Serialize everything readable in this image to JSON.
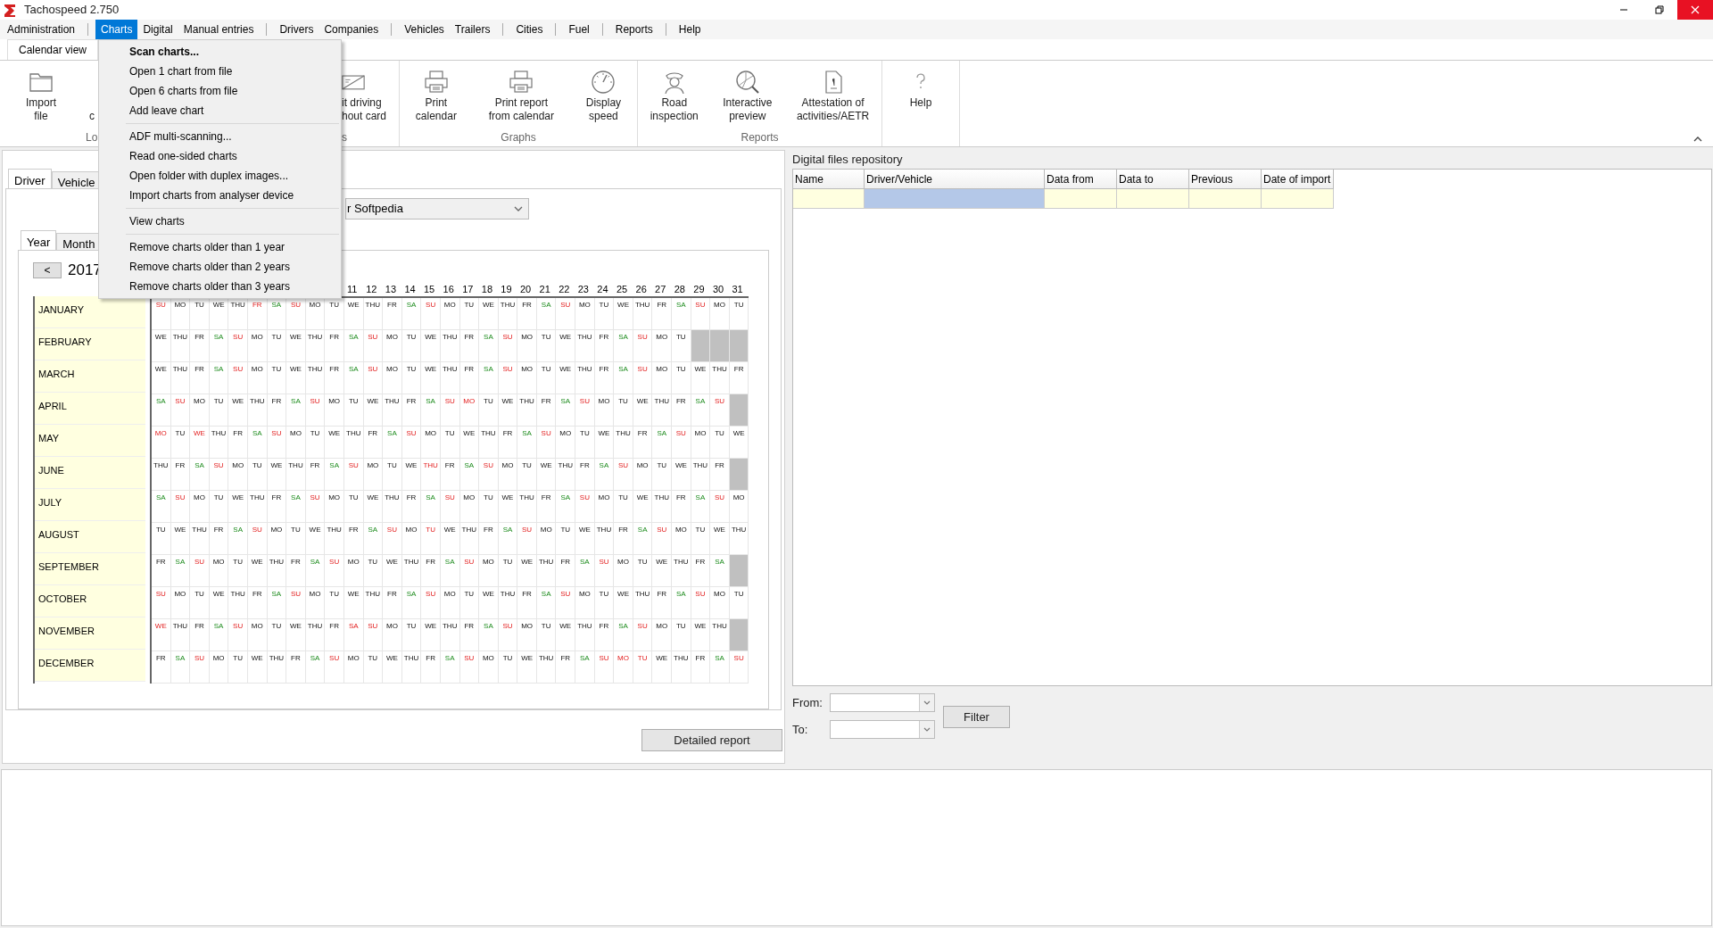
{
  "window": {
    "title": "Tachospeed 2.750"
  },
  "menu_bar": [
    {
      "label": "Administration",
      "selected": false,
      "separator_after": true
    },
    {
      "label": "Charts",
      "selected": true,
      "separator_after": false
    },
    {
      "label": "Digital",
      "selected": false,
      "separator_after": false
    },
    {
      "label": "Manual entries",
      "selected": false,
      "separator_after": true
    },
    {
      "label": "Drivers",
      "selected": false,
      "separator_after": false
    },
    {
      "label": "Companies",
      "selected": false,
      "separator_after": true
    },
    {
      "label": "Vehicles",
      "selected": false,
      "separator_after": false
    },
    {
      "label": "Trailers",
      "selected": false,
      "separator_after": true
    },
    {
      "label": "Cities",
      "selected": false,
      "separator_after": true
    },
    {
      "label": "Fuel",
      "selected": false,
      "separator_after": true
    },
    {
      "label": "Reports",
      "selected": false,
      "separator_after": true
    },
    {
      "label": "Help",
      "selected": false,
      "separator_after": false
    }
  ],
  "view_tab": {
    "label": "Calendar view"
  },
  "ribbon": {
    "groups": [
      {
        "label": "Lo",
        "buttons": [
          {
            "lines": [
              "Import",
              "file"
            ],
            "kind": "full"
          },
          {
            "lines": [
              "c"
            ],
            "kind": "clipped"
          }
        ]
      },
      {
        "label": "s",
        "buttons": [
          {
            "lines": [
              "it driving",
              "hout card"
            ],
            "kind": "clipped"
          }
        ]
      },
      {
        "label": "Graphs",
        "buttons": [
          {
            "lines": [
              "Print",
              "calendar"
            ],
            "kind": "full"
          },
          {
            "lines": [
              "Print report",
              "from calendar"
            ],
            "kind": "full"
          },
          {
            "lines": [
              "Display",
              "speed"
            ],
            "kind": "full"
          }
        ]
      },
      {
        "label": "Reports",
        "buttons": [
          {
            "lines": [
              "Road",
              "inspection"
            ],
            "kind": "full"
          },
          {
            "lines": [
              "Interactive",
              "preview"
            ],
            "kind": "full"
          },
          {
            "lines": [
              "Attestation of",
              "activities/AETR"
            ],
            "kind": "full"
          }
        ]
      },
      {
        "buttons": [
          {
            "lines": [
              "Help"
            ],
            "kind": "full"
          }
        ]
      }
    ]
  },
  "charts_menu": {
    "groups": [
      [
        {
          "label": "Scan charts...",
          "default": true
        },
        {
          "label": "Open 1 chart from file",
          "default": false
        },
        {
          "label": "Open 6 charts from file",
          "default": false
        },
        {
          "label": "Add leave chart",
          "default": false
        }
      ],
      [
        {
          "label": "ADF multi-scanning...",
          "default": false
        },
        {
          "label": "Read one-sided charts",
          "default": false
        },
        {
          "label": "Open folder with duplex images...",
          "default": false
        },
        {
          "label": "Import charts from analyser device",
          "default": false
        }
      ],
      [
        {
          "label": "View charts",
          "default": false
        }
      ],
      [
        {
          "label": "Remove charts older than 1 year",
          "default": false
        },
        {
          "label": "Remove charts older than 2 years",
          "default": false
        },
        {
          "label": "Remove charts older than 3 years",
          "default": false
        }
      ]
    ]
  },
  "left_panel": {
    "tabs": [
      {
        "label": "Driver",
        "selected": true
      },
      {
        "label": "Vehicle",
        "selected": false
      }
    ],
    "driver_select": {
      "value": "r Softpedia"
    },
    "period_tabs": [
      {
        "label": "Year",
        "selected": true
      },
      {
        "label": "Month",
        "selected": false
      }
    ],
    "prev_button": "<",
    "year": "2017",
    "day_numbers": [
      "11",
      "12",
      "13",
      "14",
      "15",
      "16",
      "17",
      "18",
      "19",
      "20",
      "21",
      "22",
      "23",
      "24",
      "25",
      "26",
      "27",
      "28",
      "29",
      "30",
      "31"
    ],
    "months": [
      {
        "name": "JANUARY",
        "days": [
          {
            "label": "SU",
            "kind": "red"
          },
          {
            "label": "MO",
            "kind": "work"
          },
          {
            "label": "TU",
            "kind": "work"
          },
          {
            "label": "WE",
            "kind": "work"
          },
          {
            "label": "THU",
            "kind": "work"
          },
          {
            "label": "FR",
            "kind": "red"
          },
          {
            "label": "SA",
            "kind": "sat"
          },
          {
            "label": "SU",
            "kind": "red"
          },
          {
            "label": "MO",
            "kind": "work"
          },
          {
            "label": "TU",
            "kind": "work"
          },
          {
            "label": "WE",
            "kind": "work"
          },
          {
            "label": "THU",
            "kind": "work"
          },
          {
            "label": "FR",
            "kind": "work"
          },
          {
            "label": "SA",
            "kind": "sat"
          },
          {
            "label": "SU",
            "kind": "red"
          },
          {
            "label": "MO",
            "kind": "work"
          },
          {
            "label": "TU",
            "kind": "work"
          },
          {
            "label": "WE",
            "kind": "work"
          },
          {
            "label": "THU",
            "kind": "work"
          },
          {
            "label": "FR",
            "kind": "work"
          },
          {
            "label": "SA",
            "kind": "sat"
          },
          {
            "label": "SU",
            "kind": "red"
          },
          {
            "label": "MO",
            "kind": "work"
          },
          {
            "label": "TU",
            "kind": "work"
          },
          {
            "label": "WE",
            "kind": "work"
          },
          {
            "label": "THU",
            "kind": "work"
          },
          {
            "label": "FR",
            "kind": "work"
          },
          {
            "label": "SA",
            "kind": "sat"
          },
          {
            "label": "SU",
            "kind": "red"
          },
          {
            "label": "MO",
            "kind": "work"
          },
          {
            "label": "TU",
            "kind": "work"
          }
        ]
      },
      {
        "name": "FEBRUARY",
        "days": [
          {
            "label": "WE",
            "kind": "work"
          },
          {
            "label": "THU",
            "kind": "work"
          },
          {
            "label": "FR",
            "kind": "work"
          },
          {
            "label": "SA",
            "kind": "sat"
          },
          {
            "label": "SU",
            "kind": "red"
          },
          {
            "label": "MO",
            "kind": "work"
          },
          {
            "label": "TU",
            "kind": "work"
          },
          {
            "label": "WE",
            "kind": "work"
          },
          {
            "label": "THU",
            "kind": "work"
          },
          {
            "label": "FR",
            "kind": "work"
          },
          {
            "label": "SA",
            "kind": "sat"
          },
          {
            "label": "SU",
            "kind": "red"
          },
          {
            "label": "MO",
            "kind": "work"
          },
          {
            "label": "TU",
            "kind": "work"
          },
          {
            "label": "WE",
            "kind": "work"
          },
          {
            "label": "THU",
            "kind": "work"
          },
          {
            "label": "FR",
            "kind": "work"
          },
          {
            "label": "SA",
            "kind": "sat"
          },
          {
            "label": "SU",
            "kind": "red"
          },
          {
            "label": "MO",
            "kind": "work"
          },
          {
            "label": "TU",
            "kind": "work"
          },
          {
            "label": "WE",
            "kind": "work"
          },
          {
            "label": "THU",
            "kind": "work"
          },
          {
            "label": "FR",
            "kind": "work"
          },
          {
            "label": "SA",
            "kind": "sat"
          },
          {
            "label": "SU",
            "kind": "red"
          },
          {
            "label": "MO",
            "kind": "work"
          },
          {
            "label": "TU",
            "kind": "work"
          }
        ]
      },
      {
        "name": "MARCH",
        "days": [
          {
            "label": "WE",
            "kind": "work"
          },
          {
            "label": "THU",
            "kind": "work"
          },
          {
            "label": "FR",
            "kind": "work"
          },
          {
            "label": "SA",
            "kind": "sat"
          },
          {
            "label": "SU",
            "kind": "red"
          },
          {
            "label": "MO",
            "kind": "work"
          },
          {
            "label": "TU",
            "kind": "work"
          },
          {
            "label": "WE",
            "kind": "work"
          },
          {
            "label": "THU",
            "kind": "work"
          },
          {
            "label": "FR",
            "kind": "work"
          },
          {
            "label": "SA",
            "kind": "sat"
          },
          {
            "label": "SU",
            "kind": "red"
          },
          {
            "label": "MO",
            "kind": "work"
          },
          {
            "label": "TU",
            "kind": "work"
          },
          {
            "label": "WE",
            "kind": "work"
          },
          {
            "label": "THU",
            "kind": "work"
          },
          {
            "label": "FR",
            "kind": "work"
          },
          {
            "label": "SA",
            "kind": "sat"
          },
          {
            "label": "SU",
            "kind": "red"
          },
          {
            "label": "MO",
            "kind": "work"
          },
          {
            "label": "TU",
            "kind": "work"
          },
          {
            "label": "WE",
            "kind": "work"
          },
          {
            "label": "THU",
            "kind": "work"
          },
          {
            "label": "FR",
            "kind": "work"
          },
          {
            "label": "SA",
            "kind": "sat"
          },
          {
            "label": "SU",
            "kind": "red"
          },
          {
            "label": "MO",
            "kind": "work"
          },
          {
            "label": "TU",
            "kind": "work"
          },
          {
            "label": "WE",
            "kind": "work"
          },
          {
            "label": "THU",
            "kind": "work"
          },
          {
            "label": "FR",
            "kind": "work"
          }
        ]
      },
      {
        "name": "APRIL",
        "days": [
          {
            "label": "SA",
            "kind": "sat"
          },
          {
            "label": "SU",
            "kind": "red"
          },
          {
            "label": "MO",
            "kind": "work"
          },
          {
            "label": "TU",
            "kind": "work"
          },
          {
            "label": "WE",
            "kind": "work"
          },
          {
            "label": "THU",
            "kind": "work"
          },
          {
            "label": "FR",
            "kind": "work"
          },
          {
            "label": "SA",
            "kind": "sat"
          },
          {
            "label": "SU",
            "kind": "red"
          },
          {
            "label": "MO",
            "kind": "work"
          },
          {
            "label": "TU",
            "kind": "work"
          },
          {
            "label": "WE",
            "kind": "work"
          },
          {
            "label": "THU",
            "kind": "work"
          },
          {
            "label": "FR",
            "kind": "work"
          },
          {
            "label": "SA",
            "kind": "sat"
          },
          {
            "label": "SU",
            "kind": "red"
          },
          {
            "label": "MO",
            "kind": "red"
          },
          {
            "label": "TU",
            "kind": "work"
          },
          {
            "label": "WE",
            "kind": "work"
          },
          {
            "label": "THU",
            "kind": "work"
          },
          {
            "label": "FR",
            "kind": "work"
          },
          {
            "label": "SA",
            "kind": "sat"
          },
          {
            "label": "SU",
            "kind": "red"
          },
          {
            "label": "MO",
            "kind": "work"
          },
          {
            "label": "TU",
            "kind": "work"
          },
          {
            "label": "WE",
            "kind": "work"
          },
          {
            "label": "THU",
            "kind": "work"
          },
          {
            "label": "FR",
            "kind": "work"
          },
          {
            "label": "SA",
            "kind": "sat"
          },
          {
            "label": "SU",
            "kind": "red"
          }
        ]
      },
      {
        "name": "MAY",
        "days": [
          {
            "label": "MO",
            "kind": "red"
          },
          {
            "label": "TU",
            "kind": "work"
          },
          {
            "label": "WE",
            "kind": "red"
          },
          {
            "label": "THU",
            "kind": "work"
          },
          {
            "label": "FR",
            "kind": "work"
          },
          {
            "label": "SA",
            "kind": "sat"
          },
          {
            "label": "SU",
            "kind": "red"
          },
          {
            "label": "MO",
            "kind": "work"
          },
          {
            "label": "TU",
            "kind": "work"
          },
          {
            "label": "WE",
            "kind": "work"
          },
          {
            "label": "THU",
            "kind": "work"
          },
          {
            "label": "FR",
            "kind": "work"
          },
          {
            "label": "SA",
            "kind": "sat"
          },
          {
            "label": "SU",
            "kind": "red"
          },
          {
            "label": "MO",
            "kind": "work"
          },
          {
            "label": "TU",
            "kind": "work"
          },
          {
            "label": "WE",
            "kind": "work"
          },
          {
            "label": "THU",
            "kind": "work"
          },
          {
            "label": "FR",
            "kind": "work"
          },
          {
            "label": "SA",
            "kind": "sat"
          },
          {
            "label": "SU",
            "kind": "red"
          },
          {
            "label": "MO",
            "kind": "work"
          },
          {
            "label": "TU",
            "kind": "work"
          },
          {
            "label": "WE",
            "kind": "work"
          },
          {
            "label": "THU",
            "kind": "work"
          },
          {
            "label": "FR",
            "kind": "work"
          },
          {
            "label": "SA",
            "kind": "sat"
          },
          {
            "label": "SU",
            "kind": "red"
          },
          {
            "label": "MO",
            "kind": "work"
          },
          {
            "label": "TU",
            "kind": "work"
          },
          {
            "label": "WE",
            "kind": "work"
          }
        ]
      },
      {
        "name": "JUNE",
        "days": [
          {
            "label": "THU",
            "kind": "work"
          },
          {
            "label": "FR",
            "kind": "work"
          },
          {
            "label": "SA",
            "kind": "sat"
          },
          {
            "label": "SU",
            "kind": "red"
          },
          {
            "label": "MO",
            "kind": "work"
          },
          {
            "label": "TU",
            "kind": "work"
          },
          {
            "label": "WE",
            "kind": "work"
          },
          {
            "label": "THU",
            "kind": "work"
          },
          {
            "label": "FR",
            "kind": "work"
          },
          {
            "label": "SA",
            "kind": "sat"
          },
          {
            "label": "SU",
            "kind": "red"
          },
          {
            "label": "MO",
            "kind": "work"
          },
          {
            "label": "TU",
            "kind": "work"
          },
          {
            "label": "WE",
            "kind": "work"
          },
          {
            "label": "THU",
            "kind": "red"
          },
          {
            "label": "FR",
            "kind": "work"
          },
          {
            "label": "SA",
            "kind": "sat"
          },
          {
            "label": "SU",
            "kind": "red"
          },
          {
            "label": "MO",
            "kind": "work"
          },
          {
            "label": "TU",
            "kind": "work"
          },
          {
            "label": "WE",
            "kind": "work"
          },
          {
            "label": "THU",
            "kind": "work"
          },
          {
            "label": "FR",
            "kind": "work"
          },
          {
            "label": "SA",
            "kind": "sat"
          },
          {
            "label": "SU",
            "kind": "red"
          },
          {
            "label": "MO",
            "kind": "work"
          },
          {
            "label": "TU",
            "kind": "work"
          },
          {
            "label": "WE",
            "kind": "work"
          },
          {
            "label": "THU",
            "kind": "work"
          },
          {
            "label": "FR",
            "kind": "work"
          }
        ]
      },
      {
        "name": "JULY",
        "days": [
          {
            "label": "SA",
            "kind": "sat"
          },
          {
            "label": "SU",
            "kind": "red"
          },
          {
            "label": "MO",
            "kind": "work"
          },
          {
            "label": "TU",
            "kind": "work"
          },
          {
            "label": "WE",
            "kind": "work"
          },
          {
            "label": "THU",
            "kind": "work"
          },
          {
            "label": "FR",
            "kind": "work"
          },
          {
            "label": "SA",
            "kind": "sat"
          },
          {
            "label": "SU",
            "kind": "red"
          },
          {
            "label": "MO",
            "kind": "work"
          },
          {
            "label": "TU",
            "kind": "work"
          },
          {
            "label": "WE",
            "kind": "work"
          },
          {
            "label": "THU",
            "kind": "work"
          },
          {
            "label": "FR",
            "kind": "work"
          },
          {
            "label": "SA",
            "kind": "sat"
          },
          {
            "label": "SU",
            "kind": "red"
          },
          {
            "label": "MO",
            "kind": "work"
          },
          {
            "label": "TU",
            "kind": "work"
          },
          {
            "label": "WE",
            "kind": "work"
          },
          {
            "label": "THU",
            "kind": "work"
          },
          {
            "label": "FR",
            "kind": "work"
          },
          {
            "label": "SA",
            "kind": "sat"
          },
          {
            "label": "SU",
            "kind": "red"
          },
          {
            "label": "MO",
            "kind": "work"
          },
          {
            "label": "TU",
            "kind": "work"
          },
          {
            "label": "WE",
            "kind": "work"
          },
          {
            "label": "THU",
            "kind": "work"
          },
          {
            "label": "FR",
            "kind": "work"
          },
          {
            "label": "SA",
            "kind": "sat"
          },
          {
            "label": "SU",
            "kind": "red"
          },
          {
            "label": "MO",
            "kind": "work"
          }
        ]
      },
      {
        "name": "AUGUST",
        "days": [
          {
            "label": "TU",
            "kind": "work"
          },
          {
            "label": "WE",
            "kind": "work"
          },
          {
            "label": "THU",
            "kind": "work"
          },
          {
            "label": "FR",
            "kind": "work"
          },
          {
            "label": "SA",
            "kind": "sat"
          },
          {
            "label": "SU",
            "kind": "red"
          },
          {
            "label": "MO",
            "kind": "work"
          },
          {
            "label": "TU",
            "kind": "work"
          },
          {
            "label": "WE",
            "kind": "work"
          },
          {
            "label": "THU",
            "kind": "work"
          },
          {
            "label": "FR",
            "kind": "work"
          },
          {
            "label": "SA",
            "kind": "sat"
          },
          {
            "label": "SU",
            "kind": "red"
          },
          {
            "label": "MO",
            "kind": "work"
          },
          {
            "label": "TU",
            "kind": "red"
          },
          {
            "label": "WE",
            "kind": "work"
          },
          {
            "label": "THU",
            "kind": "work"
          },
          {
            "label": "FR",
            "kind": "work"
          },
          {
            "label": "SA",
            "kind": "sat"
          },
          {
            "label": "SU",
            "kind": "red"
          },
          {
            "label": "MO",
            "kind": "work"
          },
          {
            "label": "TU",
            "kind": "work"
          },
          {
            "label": "WE",
            "kind": "work"
          },
          {
            "label": "THU",
            "kind": "work"
          },
          {
            "label": "FR",
            "kind": "work"
          },
          {
            "label": "SA",
            "kind": "sat"
          },
          {
            "label": "SU",
            "kind": "red"
          },
          {
            "label": "MO",
            "kind": "work"
          },
          {
            "label": "TU",
            "kind": "work"
          },
          {
            "label": "WE",
            "kind": "work"
          },
          {
            "label": "THU",
            "kind": "work"
          }
        ]
      },
      {
        "name": "SEPTEMBER",
        "days": [
          {
            "label": "FR",
            "kind": "work"
          },
          {
            "label": "SA",
            "kind": "sat"
          },
          {
            "label": "SU",
            "kind": "red"
          },
          {
            "label": "MO",
            "kind": "work"
          },
          {
            "label": "TU",
            "kind": "work"
          },
          {
            "label": "WE",
            "kind": "work"
          },
          {
            "label": "THU",
            "kind": "work"
          },
          {
            "label": "FR",
            "kind": "work"
          },
          {
            "label": "SA",
            "kind": "sat"
          },
          {
            "label": "SU",
            "kind": "red"
          },
          {
            "label": "MO",
            "kind": "work"
          },
          {
            "label": "TU",
            "kind": "work"
          },
          {
            "label": "WE",
            "kind": "work"
          },
          {
            "label": "THU",
            "kind": "work"
          },
          {
            "label": "FR",
            "kind": "work"
          },
          {
            "label": "SA",
            "kind": "sat"
          },
          {
            "label": "SU",
            "kind": "red"
          },
          {
            "label": "MO",
            "kind": "work"
          },
          {
            "label": "TU",
            "kind": "work"
          },
          {
            "label": "WE",
            "kind": "work"
          },
          {
            "label": "THU",
            "kind": "work"
          },
          {
            "label": "FR",
            "kind": "work"
          },
          {
            "label": "SA",
            "kind": "sat"
          },
          {
            "label": "SU",
            "kind": "red"
          },
          {
            "label": "MO",
            "kind": "work"
          },
          {
            "label": "TU",
            "kind": "work"
          },
          {
            "label": "WE",
            "kind": "work"
          },
          {
            "label": "THU",
            "kind": "work"
          },
          {
            "label": "FR",
            "kind": "work"
          },
          {
            "label": "SA",
            "kind": "sat"
          }
        ]
      },
      {
        "name": "OCTOBER",
        "days": [
          {
            "label": "SU",
            "kind": "red"
          },
          {
            "label": "MO",
            "kind": "work"
          },
          {
            "label": "TU",
            "kind": "work"
          },
          {
            "label": "WE",
            "kind": "work"
          },
          {
            "label": "THU",
            "kind": "work"
          },
          {
            "label": "FR",
            "kind": "work"
          },
          {
            "label": "SA",
            "kind": "sat"
          },
          {
            "label": "SU",
            "kind": "red"
          },
          {
            "label": "MO",
            "kind": "work"
          },
          {
            "label": "TU",
            "kind": "work"
          },
          {
            "label": "WE",
            "kind": "work"
          },
          {
            "label": "THU",
            "kind": "work"
          },
          {
            "label": "FR",
            "kind": "work"
          },
          {
            "label": "SA",
            "kind": "sat"
          },
          {
            "label": "SU",
            "kind": "red"
          },
          {
            "label": "MO",
            "kind": "work"
          },
          {
            "label": "TU",
            "kind": "work"
          },
          {
            "label": "WE",
            "kind": "work"
          },
          {
            "label": "THU",
            "kind": "work"
          },
          {
            "label": "FR",
            "kind": "work"
          },
          {
            "label": "SA",
            "kind": "sat"
          },
          {
            "label": "SU",
            "kind": "red"
          },
          {
            "label": "MO",
            "kind": "work"
          },
          {
            "label": "TU",
            "kind": "work"
          },
          {
            "label": "WE",
            "kind": "work"
          },
          {
            "label": "THU",
            "kind": "work"
          },
          {
            "label": "FR",
            "kind": "work"
          },
          {
            "label": "SA",
            "kind": "sat"
          },
          {
            "label": "SU",
            "kind": "red"
          },
          {
            "label": "MO",
            "kind": "work"
          },
          {
            "label": "TU",
            "kind": "work"
          }
        ]
      },
      {
        "name": "NOVEMBER",
        "days": [
          {
            "label": "WE",
            "kind": "red"
          },
          {
            "label": "THU",
            "kind": "work"
          },
          {
            "label": "FR",
            "kind": "work"
          },
          {
            "label": "SA",
            "kind": "sat"
          },
          {
            "label": "SU",
            "kind": "red"
          },
          {
            "label": "MO",
            "kind": "work"
          },
          {
            "label": "TU",
            "kind": "work"
          },
          {
            "label": "WE",
            "kind": "work"
          },
          {
            "label": "THU",
            "kind": "work"
          },
          {
            "label": "FR",
            "kind": "work"
          },
          {
            "label": "SA",
            "kind": "red"
          },
          {
            "label": "SU",
            "kind": "red"
          },
          {
            "label": "MO",
            "kind": "work"
          },
          {
            "label": "TU",
            "kind": "work"
          },
          {
            "label": "WE",
            "kind": "work"
          },
          {
            "label": "THU",
            "kind": "work"
          },
          {
            "label": "FR",
            "kind": "work"
          },
          {
            "label": "SA",
            "kind": "sat"
          },
          {
            "label": "SU",
            "kind": "red"
          },
          {
            "label": "MO",
            "kind": "work"
          },
          {
            "label": "TU",
            "kind": "work"
          },
          {
            "label": "WE",
            "kind": "work"
          },
          {
            "label": "THU",
            "kind": "work"
          },
          {
            "label": "FR",
            "kind": "work"
          },
          {
            "label": "SA",
            "kind": "sat"
          },
          {
            "label": "SU",
            "kind": "red"
          },
          {
            "label": "MO",
            "kind": "work"
          },
          {
            "label": "TU",
            "kind": "work"
          },
          {
            "label": "WE",
            "kind": "work"
          },
          {
            "label": "THU",
            "kind": "work"
          }
        ]
      },
      {
        "name": "DECEMBER",
        "days": [
          {
            "label": "FR",
            "kind": "work"
          },
          {
            "label": "SA",
            "kind": "sat"
          },
          {
            "label": "SU",
            "kind": "red"
          },
          {
            "label": "MO",
            "kind": "work"
          },
          {
            "label": "TU",
            "kind": "work"
          },
          {
            "label": "WE",
            "kind": "work"
          },
          {
            "label": "THU",
            "kind": "work"
          },
          {
            "label": "FR",
            "kind": "work"
          },
          {
            "label": "SA",
            "kind": "sat"
          },
          {
            "label": "SU",
            "kind": "red"
          },
          {
            "label": "MO",
            "kind": "work"
          },
          {
            "label": "TU",
            "kind": "work"
          },
          {
            "label": "WE",
            "kind": "work"
          },
          {
            "label": "THU",
            "kind": "work"
          },
          {
            "label": "FR",
            "kind": "work"
          },
          {
            "label": "SA",
            "kind": "sat"
          },
          {
            "label": "SU",
            "kind": "red"
          },
          {
            "label": "MO",
            "kind": "work"
          },
          {
            "label": "TU",
            "kind": "work"
          },
          {
            "label": "WE",
            "kind": "work"
          },
          {
            "label": "THU",
            "kind": "work"
          },
          {
            "label": "FR",
            "kind": "work"
          },
          {
            "label": "SA",
            "kind": "sat"
          },
          {
            "label": "SU",
            "kind": "red"
          },
          {
            "label": "MO",
            "kind": "red"
          },
          {
            "label": "TU",
            "kind": "red"
          },
          {
            "label": "WE",
            "kind": "work"
          },
          {
            "label": "THU",
            "kind": "work"
          },
          {
            "label": "FR",
            "kind": "work"
          },
          {
            "label": "SA",
            "kind": "sat"
          },
          {
            "label": "SU",
            "kind": "red"
          }
        ]
      }
    ],
    "detailed_report_button": "Detailed report"
  },
  "right_panel": {
    "title": "Digital files repository",
    "table": {
      "columns": [
        "Name",
        "Driver/Vehicle",
        "Data from",
        "Data to",
        "Previous",
        "Date of import"
      ],
      "rows": [
        {
          "cells": [
            {
              "selected": false
            },
            {
              "selected": true
            },
            {
              "selected": false
            },
            {
              "selected": false
            },
            {
              "selected": false
            },
            {
              "selected": false
            }
          ]
        }
      ]
    },
    "from_label": "From:",
    "to_label": "To:",
    "filter_button": "Filter"
  }
}
